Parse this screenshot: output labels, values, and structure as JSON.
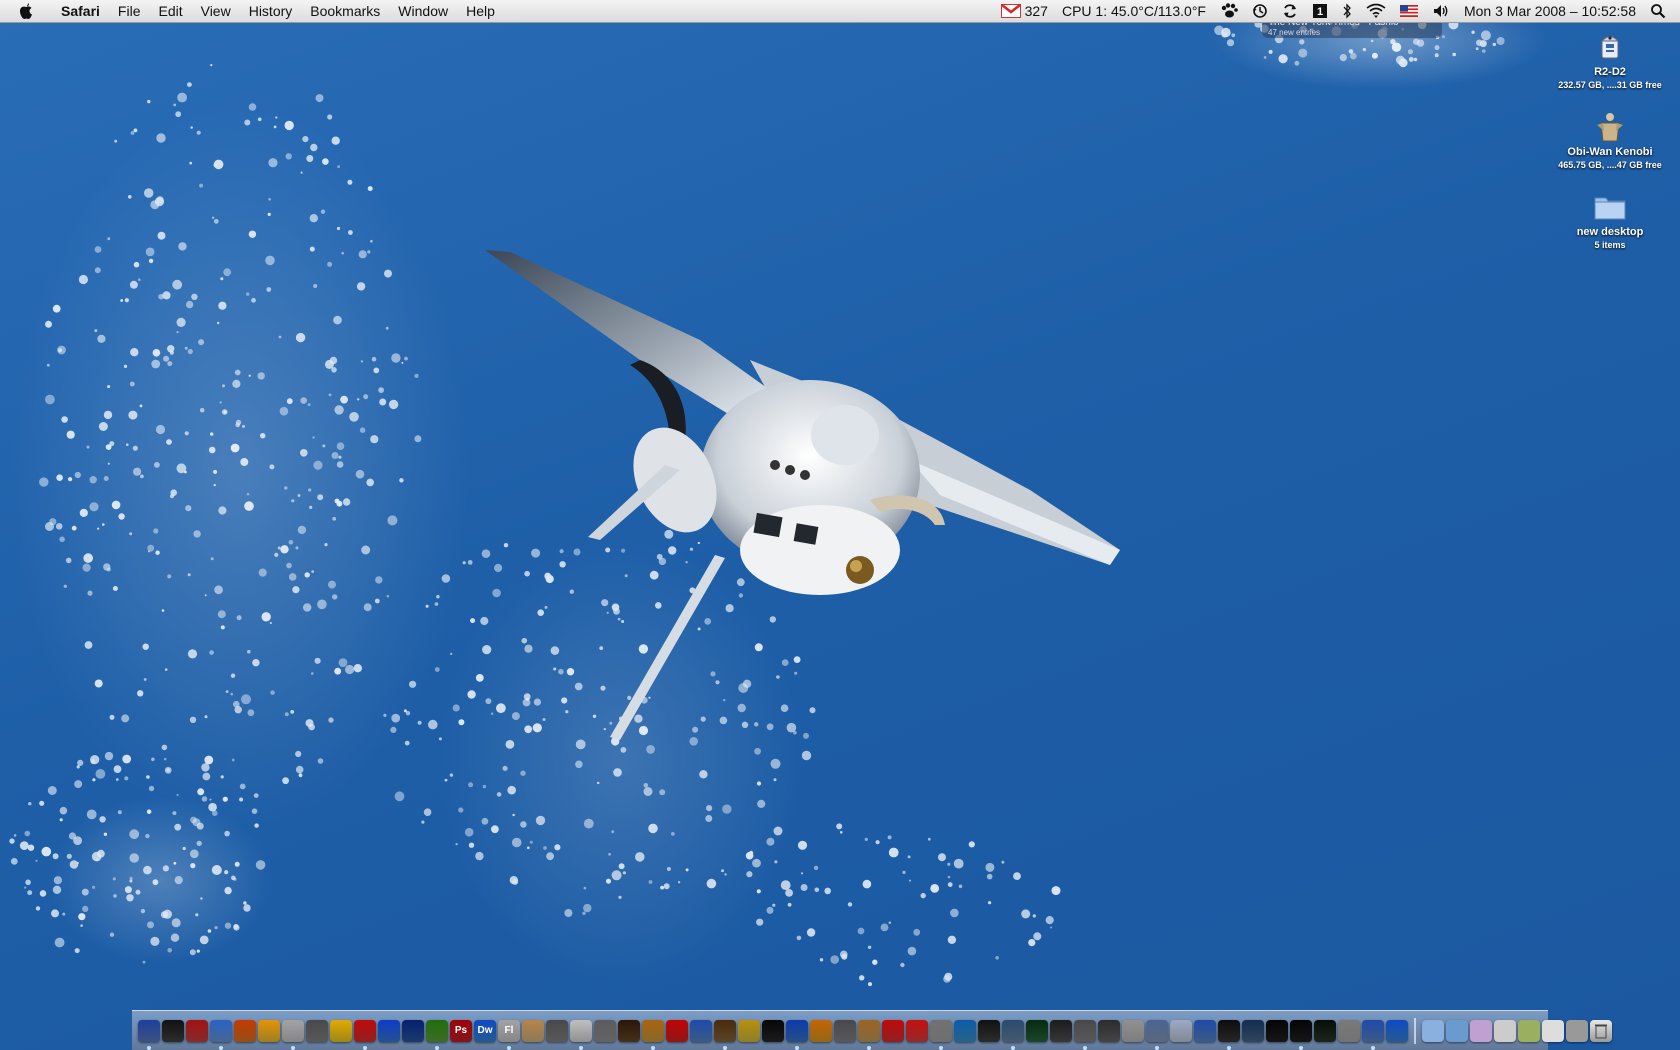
{
  "menubar": {
    "app_name": "Safari",
    "menus": [
      "File",
      "Edit",
      "View",
      "History",
      "Bookmarks",
      "Window",
      "Help"
    ],
    "status": {
      "mail_count": "327",
      "cpu_text": "CPU 1: 45.0°C/113.0°F",
      "datetime": "Mon 3 Mar 2008 – 10:52:58"
    }
  },
  "notification": {
    "title": "The New York Times - Fashio",
    "subtitle": "47 new entries"
  },
  "desktop_icons": [
    {
      "name": "R2-D2",
      "info": "232.57 GB, ....31 GB free",
      "icon": "r2d2-drive-icon"
    },
    {
      "name": "Obi-Wan Kenobi",
      "info": "465.75 GB, ....47 GB free",
      "icon": "obiwan-drive-icon"
    },
    {
      "name": "new desktop",
      "info": "5 items",
      "icon": "folder-icon"
    }
  ],
  "dock": {
    "labels": {
      "ps": "Ps",
      "dw": "Dw",
      "fl": "Fl"
    },
    "colors": [
      "#5a7fc8",
      "#444",
      "#c44",
      "#6a9ee0",
      "#e07a20",
      "#f2c230",
      "#ccc",
      "#888",
      "#f0d020",
      "#d33",
      "#3a7de0",
      "#2a5aa8",
      "#5ba83a",
      "#c8202a",
      "#3a8ae0",
      "#ccc",
      "#d8b888",
      "#888",
      "#ddd",
      "#999",
      "#6a4a2a",
      "#d0a040",
      "#d22",
      "#5a8ad0",
      "#8a6a3a",
      "#d8c040",
      "#2a2a2a",
      "#3a7ad0",
      "#e0a020",
      "#888",
      "#c8a060",
      "#dd3333",
      "#e04040",
      "#aaa",
      "#3a9ad0",
      "#444",
      "#6a8aa8",
      "#2a6a40",
      "#555",
      "#888",
      "#6a6a6a",
      "#c0c0c0",
      "#8aa0c0",
      "#c8d0e0",
      "#5a8ad0",
      "#3a3a3a",
      "#4a6a90",
      "#222",
      "#222",
      "#2a3a2a",
      "#b0b0b0",
      "#5a8ad0",
      "#3a8ae0"
    ],
    "folder_colors": [
      "#8ab0e0",
      "#6a9ad0",
      "#c0a0d0",
      "#ccc",
      "#9ab060",
      "#ddd",
      "#999"
    ]
  }
}
